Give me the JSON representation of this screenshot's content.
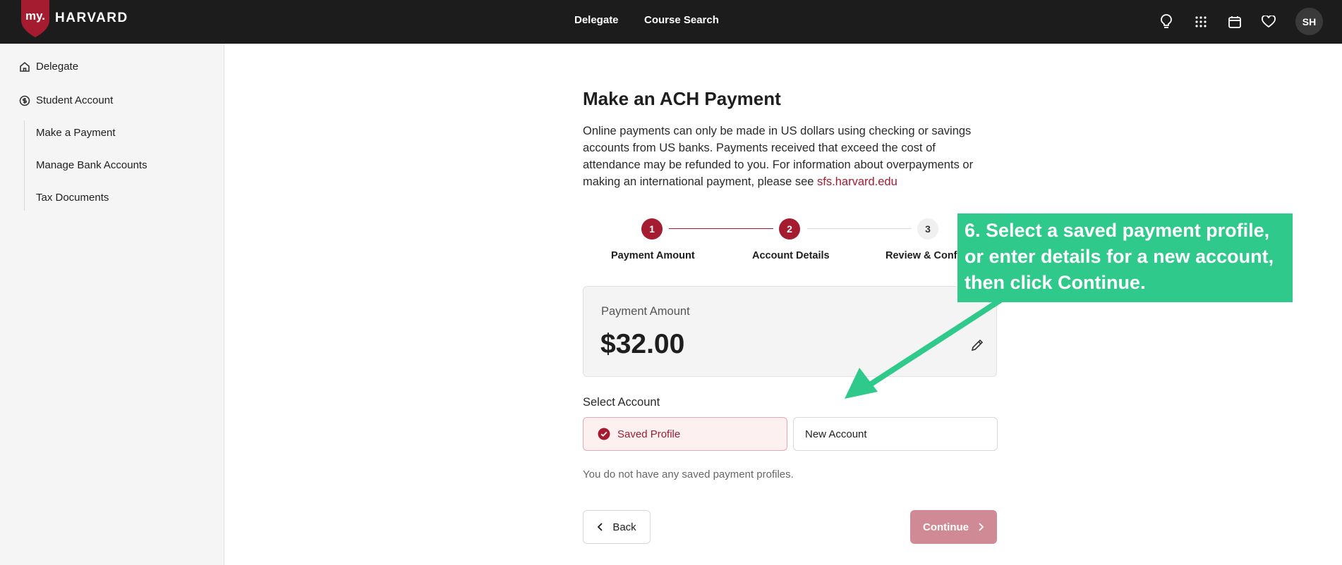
{
  "header": {
    "logo_badge": "my.",
    "logo_word": "HARVARD",
    "nav": [
      "Delegate",
      "Course Search"
    ],
    "icons": [
      "lightbulb-icon",
      "apps-grid-icon",
      "calendar-icon",
      "heart-icon"
    ],
    "avatar_initials": "SH"
  },
  "sidebar": {
    "items": [
      {
        "label": "Delegate",
        "icon": "home-icon"
      },
      {
        "label": "Student Account",
        "icon": "dollar-circle-icon"
      }
    ],
    "subitems": [
      "Make a Payment",
      "Manage Bank Accounts",
      "Tax Documents"
    ]
  },
  "main": {
    "title": "Make an ACH Payment",
    "intro": "Online payments can only be made in US dollars using checking or savings accounts from US banks. Payments received that exceed the cost of attendance may be refunded to you. For information about overpayments or making an international payment, please see ",
    "intro_link": "sfs.harvard.edu",
    "steps": [
      {
        "number": "1",
        "label": "Payment Amount"
      },
      {
        "number": "2",
        "label": "Account Details"
      },
      {
        "number": "3",
        "label": "Review & Confirm"
      }
    ],
    "current_step": 2,
    "amount_label": "Payment Amount",
    "amount_value": "$32.00",
    "select_account_label": "Select Account",
    "account_options": [
      "Saved Profile",
      "New Account"
    ],
    "selected_account": "Saved Profile",
    "no_profiles_text": "You do not have any saved payment profiles.",
    "back_label": "Back",
    "continue_label": "Continue"
  },
  "annotation": {
    "text": "6. Select a saved payment profile, or enter details for a new account, then click Continue."
  },
  "colors": {
    "brand": "#a51c30",
    "topbar": "#1c1c1c",
    "callout": "#2ec98b",
    "continue_disabled": "#d08a95"
  }
}
